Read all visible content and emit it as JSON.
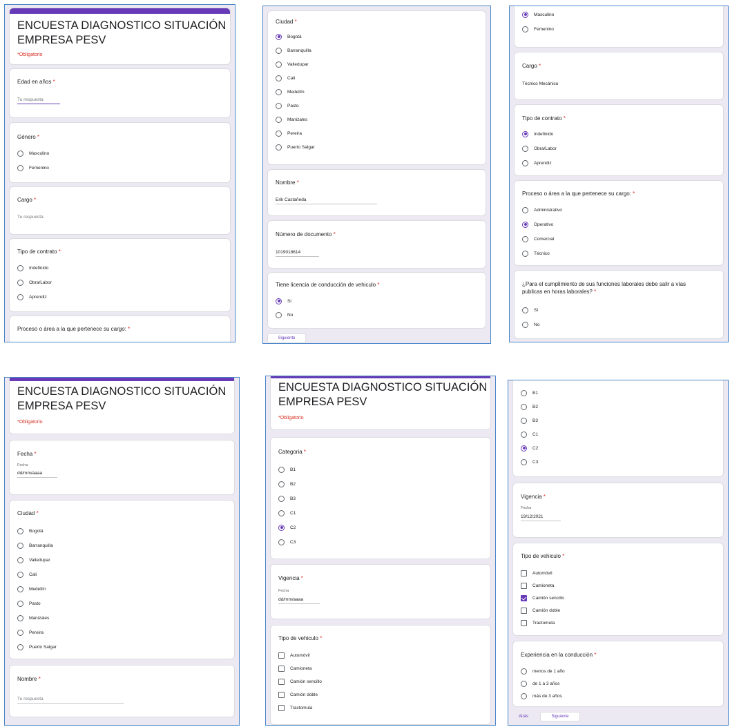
{
  "form": {
    "title_line1": "ENCUESTA DIAGNOSTICO SITUACIÓN",
    "title_line2": "EMPRESA PESV",
    "required_note": "*Obligatorio",
    "required_mark": "*",
    "your_answer_placeholder": "Tu respuesta",
    "date_sublabel": "Fecha",
    "date_placeholder": "dd/mm/aaaa"
  },
  "questions": {
    "edad": "Edad en años",
    "genero": "Género",
    "cargo": "Cargo",
    "contrato": "Tipo de contrato",
    "proceso": "Proceso o área a la que pertenece su cargo:",
    "ciudad": "Ciudad",
    "nombre": "Nombre",
    "documento": "Número de documento",
    "licencia": "Tiene licencia de conducción de vehiculo",
    "vias": "¿Para el cumplimiento de sus funciones laborales debe salir a vías publicas en horas laborales?",
    "fecha": "Fecha",
    "categoria": "Categoria",
    "vigencia": "Vigencia",
    "tipo_vehiculo": "Tipo de vehiculo",
    "experiencia": "Experiencia en la conducción"
  },
  "options": {
    "genero": [
      "Masculino",
      "Femenino"
    ],
    "contrato": [
      "Indefinido",
      "Obra/Labor",
      "Aprendiz"
    ],
    "proceso": [
      "Administrativo",
      "Operativo",
      "Comercial",
      "Técnico"
    ],
    "ciudad": [
      "Bogotá",
      "Barranquilla",
      "Valledupar",
      "Cali",
      "Medellín",
      "Pasto",
      "Manizales",
      "Pereira",
      "Puerto Salgar"
    ],
    "licencia": [
      "Si",
      "No"
    ],
    "vias": [
      "Sí",
      "No"
    ],
    "categoria": [
      "B1",
      "B2",
      "B3",
      "C1",
      "C2",
      "C3"
    ],
    "tipo_vehiculo": [
      "Automóvil",
      "Camioneta",
      "Camión sencillo",
      "Camión doble",
      "Tractomula"
    ],
    "experiencia": [
      "menos de 1 año",
      "de 1 a 3 años",
      "más de 3 años"
    ]
  },
  "answers": {
    "cargo": "Técnico Mecánico",
    "nombre": "Erik Castañeda",
    "documento": "1019018614",
    "vigencia": "19/12/2021"
  },
  "buttons": {
    "next": "Siguiente",
    "back": "Atrás"
  },
  "colors": {
    "accent": "#673ab7",
    "required": "#d93025",
    "panel_border": "#4a86c8",
    "background": "#ece9f3"
  }
}
